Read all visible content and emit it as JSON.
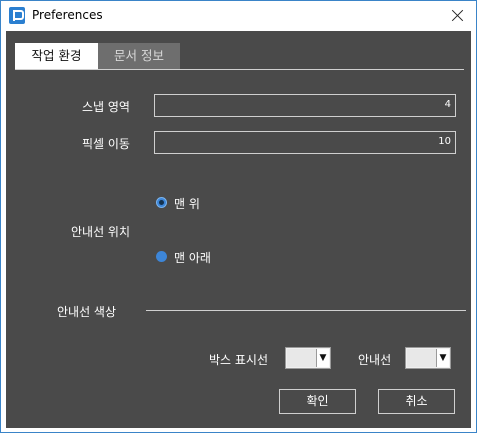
{
  "window": {
    "title": "Preferences"
  },
  "tabs": [
    {
      "label": "작업 환경",
      "active": true
    },
    {
      "label": "문서 정보",
      "active": false
    }
  ],
  "settings": {
    "snap_area_label": "스냅 영역",
    "snap_area_value": "4",
    "pixel_move_label": "픽셀 이동",
    "pixel_move_value": "10",
    "guide_position_label": "안내선 위치",
    "guide_position_options": [
      {
        "label": "맨 위",
        "selected": true
      },
      {
        "label": "맨 아래",
        "selected": false
      }
    ],
    "guide_color_label": "안내선 색상",
    "box_indicator_label": "박스 표시선",
    "guideline_label": "안내선"
  },
  "colors": {
    "box_indicator_color": "#e8e8e8",
    "guideline_color": "#e8e8e8",
    "panel_background": "#4a4a4a",
    "radio_accent": "#3d86d8"
  },
  "buttons": {
    "confirm_label": "확인",
    "cancel_label": "취소"
  }
}
